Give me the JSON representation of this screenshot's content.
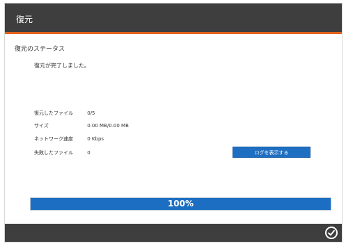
{
  "window": {
    "title": "復元"
  },
  "status": {
    "section_title": "復元のステータス",
    "message": "復元が完了しました。"
  },
  "details": [
    {
      "label": "復元したファイル",
      "value": "0/5"
    },
    {
      "label": "サイズ",
      "value": "0.00 MB/0.00 MB"
    },
    {
      "label": "ネットワーク速度",
      "value": "0 Kbps"
    },
    {
      "label": "失敗したファイル",
      "value": "0"
    }
  ],
  "detail_button": {
    "label": "ログを表示する"
  },
  "progress": {
    "value": 1.0,
    "label": "100%"
  },
  "footer": {
    "ok_icon": "check-circle-icon"
  },
  "colors": {
    "titlebar": "#3e3e3e",
    "accent": "#e2621b",
    "button": "#1e6fc2",
    "progress_fill": "#1b6ec1"
  }
}
